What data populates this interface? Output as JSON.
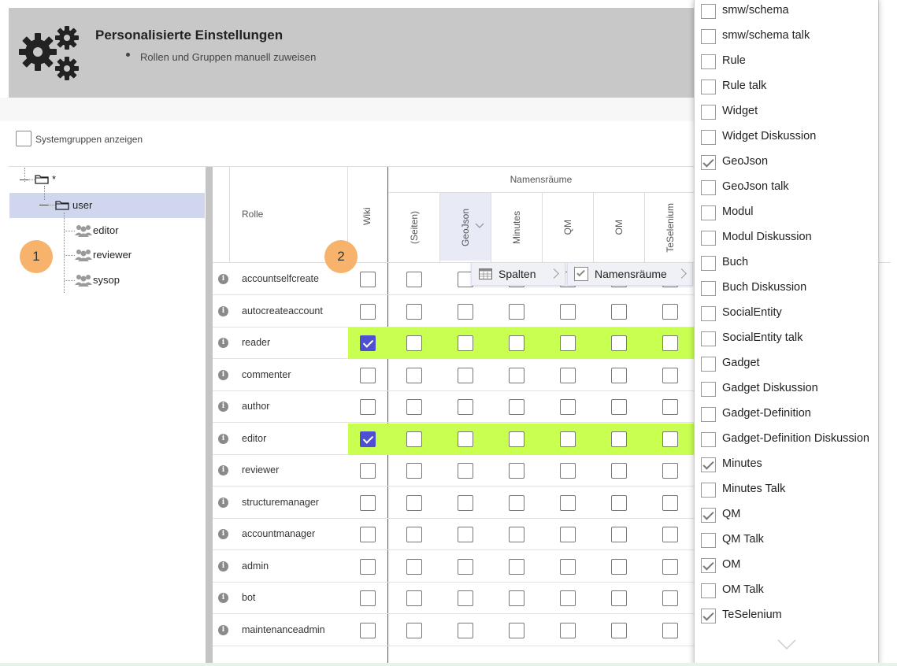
{
  "header": {
    "title": "Personalisierte Einstellungen",
    "subtitle": "Rollen und Gruppen manuell zuweisen"
  },
  "toolbar": {
    "system_groups_label": "Systemgruppen anzeigen",
    "system_groups_checked": false
  },
  "tree": {
    "root_label": "*",
    "user_label": "user",
    "groups": [
      "editor",
      "reviewer",
      "sysop"
    ]
  },
  "callouts": [
    "1",
    "2"
  ],
  "grid": {
    "namespaces_title": "Namensräume",
    "role_header": "Rolle",
    "wiki_header": "Wiki",
    "ns_columns": [
      "(Seiten)",
      "GeoJson",
      "Minutes",
      "QM",
      "OM",
      "TeSelenium"
    ],
    "rows": [
      {
        "role": "accountselfcreate",
        "wiki": false,
        "highlight": false
      },
      {
        "role": "autocreateaccount",
        "wiki": false,
        "highlight": false
      },
      {
        "role": "reader",
        "wiki": true,
        "highlight": true
      },
      {
        "role": "commenter",
        "wiki": false,
        "highlight": false
      },
      {
        "role": "author",
        "wiki": false,
        "highlight": false
      },
      {
        "role": "editor",
        "wiki": true,
        "highlight": true
      },
      {
        "role": "reviewer",
        "wiki": false,
        "highlight": false
      },
      {
        "role": "structuremanager",
        "wiki": false,
        "highlight": false
      },
      {
        "role": "accountmanager",
        "wiki": false,
        "highlight": false
      },
      {
        "role": "admin",
        "wiki": false,
        "highlight": false
      },
      {
        "role": "bot",
        "wiki": false,
        "highlight": false
      },
      {
        "role": "maintenanceadmin",
        "wiki": false,
        "highlight": false
      }
    ],
    "highlight_color": "#c8ff50",
    "checked_color": "#4e4fd2"
  },
  "context_menu": {
    "columns_label": "Spalten",
    "namespaces_label": "Namensräume"
  },
  "namespace_dropdown": [
    {
      "label": "smw/schema",
      "checked": false
    },
    {
      "label": "smw/schema talk",
      "checked": false
    },
    {
      "label": "Rule",
      "checked": false
    },
    {
      "label": "Rule talk",
      "checked": false
    },
    {
      "label": "Widget",
      "checked": false
    },
    {
      "label": "Widget Diskussion",
      "checked": false
    },
    {
      "label": "GeoJson",
      "checked": true
    },
    {
      "label": "GeoJson talk",
      "checked": false
    },
    {
      "label": "Modul",
      "checked": false
    },
    {
      "label": "Modul Diskussion",
      "checked": false
    },
    {
      "label": "Buch",
      "checked": false
    },
    {
      "label": "Buch Diskussion",
      "checked": false
    },
    {
      "label": "SocialEntity",
      "checked": false
    },
    {
      "label": "SocialEntity talk",
      "checked": false
    },
    {
      "label": "Gadget",
      "checked": false
    },
    {
      "label": "Gadget Diskussion",
      "checked": false
    },
    {
      "label": "Gadget-Definition",
      "checked": false
    },
    {
      "label": "Gadget-Definition Diskussion",
      "checked": false
    },
    {
      "label": "Minutes",
      "checked": true
    },
    {
      "label": "Minutes Talk",
      "checked": false
    },
    {
      "label": "QM",
      "checked": true
    },
    {
      "label": "QM Talk",
      "checked": false
    },
    {
      "label": "OM",
      "checked": true
    },
    {
      "label": "OM Talk",
      "checked": false
    },
    {
      "label": "TeSelenium",
      "checked": true
    }
  ],
  "icons": {
    "header": "gears-icon",
    "folder": "folder-icon",
    "group": "group-icon",
    "info": "info-icon",
    "columns": "columns-icon",
    "scroll_down": "chevron-down-icon"
  }
}
